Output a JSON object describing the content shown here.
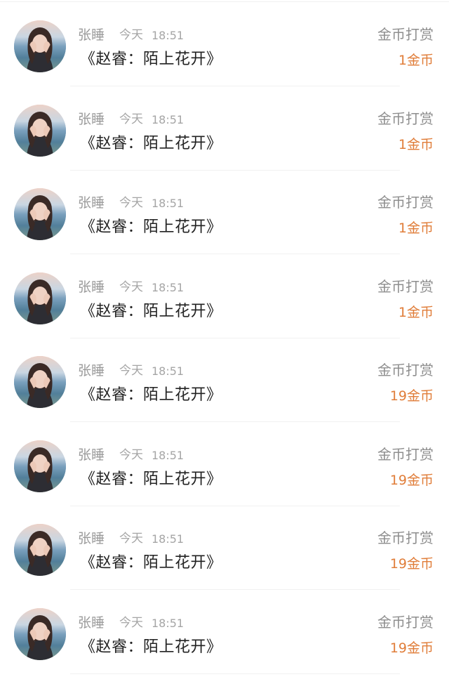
{
  "records": [
    {
      "user": "张睡",
      "day": "今天",
      "time": "18:51",
      "title": "《赵睿：陌上花开》",
      "action": "金币打赏",
      "amount": "1金币"
    },
    {
      "user": "张睡",
      "day": "今天",
      "time": "18:51",
      "title": "《赵睿：陌上花开》",
      "action": "金币打赏",
      "amount": "1金币"
    },
    {
      "user": "张睡",
      "day": "今天",
      "time": "18:51",
      "title": "《赵睿：陌上花开》",
      "action": "金币打赏",
      "amount": "1金币"
    },
    {
      "user": "张睡",
      "day": "今天",
      "time": "18:51",
      "title": "《赵睿：陌上花开》",
      "action": "金币打赏",
      "amount": "1金币"
    },
    {
      "user": "张睡",
      "day": "今天",
      "time": "18:51",
      "title": "《赵睿：陌上花开》",
      "action": "金币打赏",
      "amount": "19金币"
    },
    {
      "user": "张睡",
      "day": "今天",
      "time": "18:51",
      "title": "《赵睿：陌上花开》",
      "action": "金币打赏",
      "amount": "19金币"
    },
    {
      "user": "张睡",
      "day": "今天",
      "time": "18:51",
      "title": "《赵睿：陌上花开》",
      "action": "金币打赏",
      "amount": "19金币"
    },
    {
      "user": "张睡",
      "day": "今天",
      "time": "18:51",
      "title": "《赵睿：陌上花开》",
      "action": "金币打赏",
      "amount": "19金币"
    }
  ],
  "colors": {
    "amount": "#e07d39",
    "meta": "#a5a5a5",
    "title": "#222222"
  }
}
